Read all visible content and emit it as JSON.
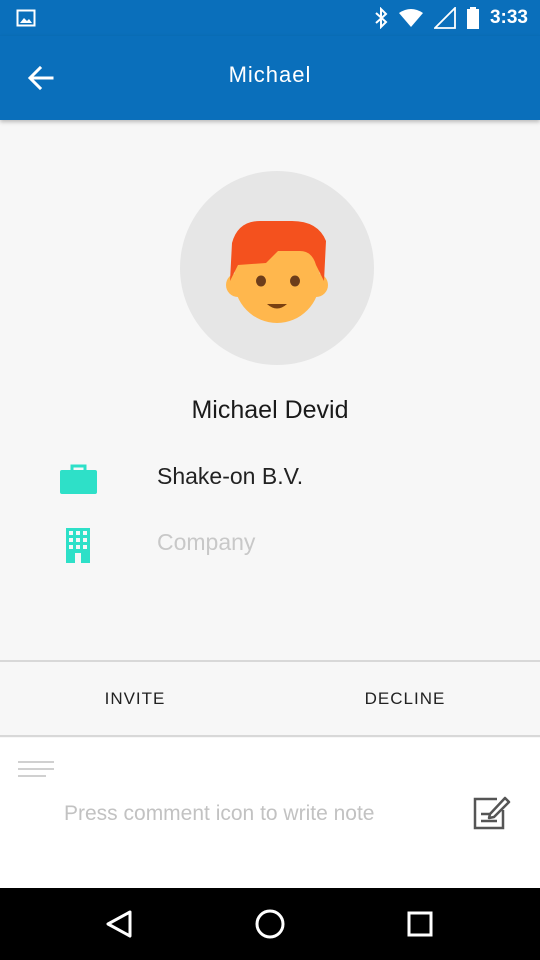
{
  "status_bar": {
    "time": "3:33",
    "icons": [
      "gallery-icon",
      "bluetooth-icon",
      "wifi-icon",
      "signal-icon",
      "battery-icon"
    ]
  },
  "app_bar": {
    "title": "Michael",
    "back_icon": "arrow-back-icon"
  },
  "profile": {
    "full_name": "Michael Devid",
    "avatar_icon": "person-avatar-icon",
    "fields": [
      {
        "icon": "briefcase-icon",
        "value": "Shake-on B.V."
      },
      {
        "icon": "building-icon",
        "value": "Company"
      }
    ]
  },
  "actions": {
    "invite_label": "INVITE",
    "decline_label": "DECLINE"
  },
  "notes": {
    "placeholder": "Press comment icon to write note",
    "icon": "edit-note-icon"
  },
  "colors": {
    "primary": "#0a6fbb",
    "accent": "#2ee0c8",
    "avatar_hair": "#f4511e",
    "avatar_skin": "#ffb74d"
  },
  "nav_bar": {
    "icons": [
      "back-triangle-icon",
      "home-circle-icon",
      "recents-square-icon"
    ]
  }
}
